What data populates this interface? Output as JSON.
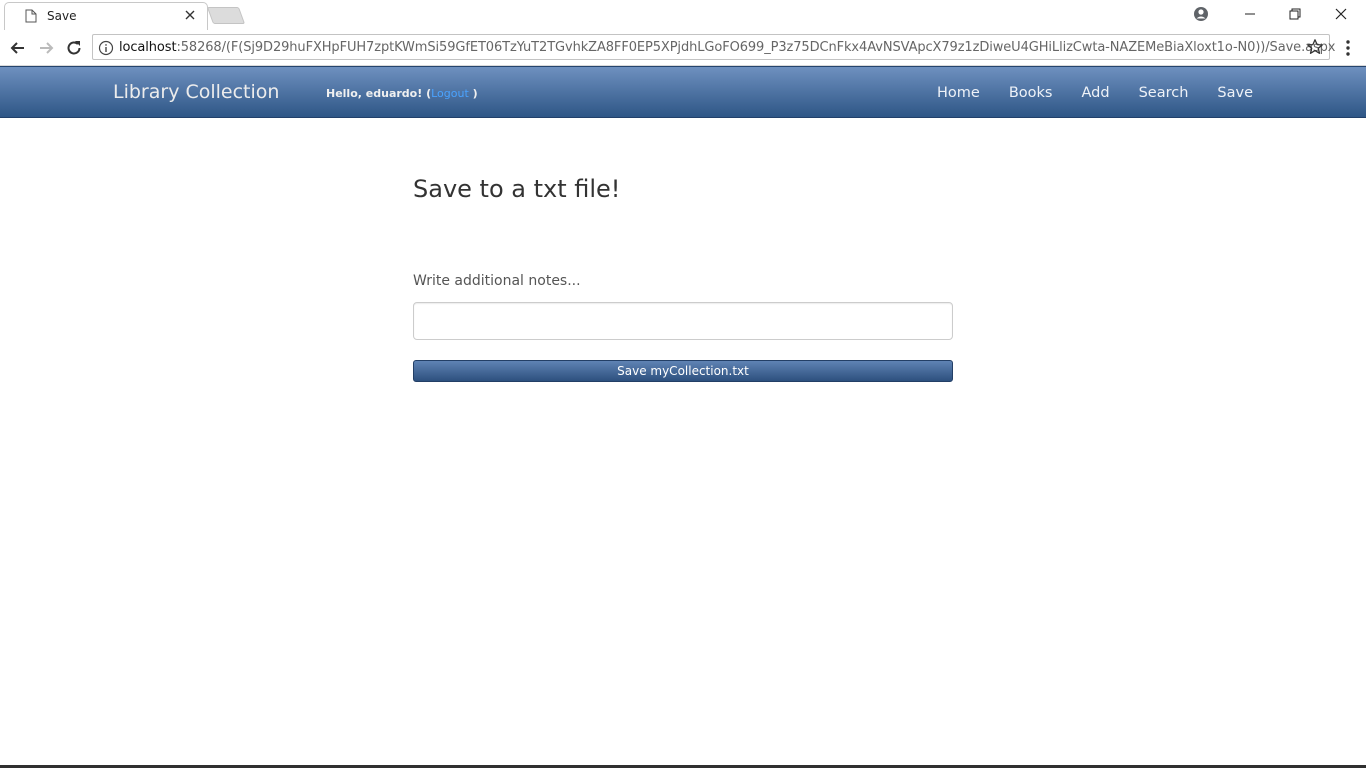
{
  "browser": {
    "tab_title": "Save",
    "url_host": "localhost",
    "url_rest": ":58268/(F(Sj9D29huFXHpFUH7zptKWmSi59GfET06TzYuT2TGvhkZA8FF0EP5XPjdhLGoFO699_P3z75DCnFkx4AvNSVApcX79z1zDiweU4GHiLlizCwta-NAZEMeBiaXloxt1o-N0))/Save.aspx"
  },
  "navbar": {
    "brand": "Library Collection",
    "greeting_prefix": "Hello, eduardo! (",
    "logout_label": "Logout",
    "greeting_suffix": " )",
    "links": [
      "Home",
      "Books",
      "Add",
      "Search",
      "Save"
    ]
  },
  "main": {
    "heading": "Save to a txt file!",
    "notes_label": "Write additional notes...",
    "notes_value": "",
    "save_button_label": "Save myCollection.txt"
  },
  "colors": {
    "navbar_top": "#6e90bf",
    "navbar_bottom": "#2e5686",
    "logout_link": "#4aa3ff",
    "button": "#3c6496"
  },
  "icons": [
    "page-icon",
    "close-icon",
    "account-icon",
    "minimize-icon",
    "restore-icon",
    "window-close-icon",
    "back-arrow-icon",
    "forward-arrow-icon",
    "reload-icon",
    "info-icon",
    "star-icon",
    "menu-dots-icon"
  ]
}
